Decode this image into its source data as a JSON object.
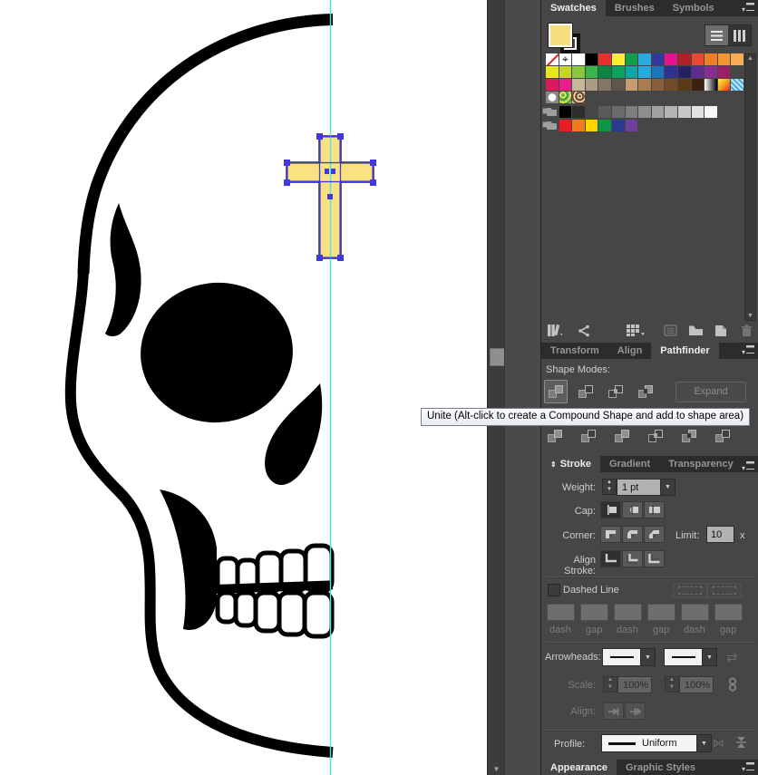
{
  "colors": {
    "canvas_bg": "#ffffff",
    "artwork": "#000000",
    "guide": "#44e6ef",
    "cross_fill": "#fae182",
    "cross_stroke": "#1f1f49",
    "selection": "#4038e0",
    "fill_proxy": "#f8df7d"
  },
  "canvas": {
    "artwork_name": "half-skull-drawing",
    "selected_object": "cross-shape"
  },
  "swatches_panel": {
    "tabs": [
      "Swatches",
      "Brushes",
      "Symbols"
    ],
    "active_tab": "Swatches",
    "view_buttons": [
      "list-view",
      "grid-view"
    ],
    "rows": [
      [
        "none",
        "registration",
        "#FFFFFF",
        "#000000",
        "#E8312F",
        "#FDEE2B",
        "#119E49",
        "#28AAE1",
        "#32399B",
        "#E8138C",
        "#B01F24",
        "#EA4835",
        "#EF7D23",
        "#F2952F",
        "#F6AC55"
      ],
      [
        "#E8E623",
        "#C6D32B",
        "#8CC63F",
        "#3AB54A",
        "#0C8442",
        "#0EA25F",
        "#10A5A5",
        "#28AAE1",
        "#1C75BC",
        "#2E3192",
        "#252163",
        "#5D2D91",
        "#8A2E92",
        "#9C1E63"
      ],
      [
        "#D91A5C",
        "#EC1E8C",
        "#C7B79C",
        "#AC9B82",
        "#837567",
        "#5F554B",
        "#C69C6D",
        "#A97D50",
        "#8A5D3B",
        "#734B24",
        "#5A3A17",
        "#3C220E",
        "grad-bw",
        "grad-fire",
        "pat-checker-blue"
      ],
      [
        "pat-dots",
        "pat-floral-green",
        "pat-texture-brown"
      ],
      [
        "folder",
        "#000000",
        "#2E2E2E",
        "#474747",
        "#5A5A5A",
        "#6B6B6B",
        "#7D7D7D",
        "#8F8F8F",
        "#A1A1A1",
        "#B4B4B4",
        "#C8C8C8",
        "#E2E2E2",
        "#F7F7F7"
      ],
      [
        "folder",
        "#EB1C24",
        "#F47A20",
        "#FFD400",
        "#0A9547",
        "#2A3B8F",
        "#6E4099"
      ]
    ],
    "footer_icons": [
      "swatch-libraries-menu",
      "add-selected",
      "show-swatch-kinds-menu",
      "swatch-options",
      "new-color-group",
      "new-swatch",
      "delete-swatch"
    ]
  },
  "pathfinder_panel": {
    "tabs": [
      "Transform",
      "Align",
      "Pathfinder"
    ],
    "active_tab": "Pathfinder",
    "section_label": "Shape Modes:",
    "shape_mode_buttons": [
      "unite",
      "minus-front",
      "intersect",
      "exclude"
    ],
    "expand_label": "Expand",
    "pathfinder_buttons": [
      "divide",
      "trim",
      "merge",
      "crop",
      "outline",
      "minus-back"
    ]
  },
  "tooltip": {
    "text": "Unite (Alt-click to create a Compound Shape and add to shape area)"
  },
  "stroke_panel": {
    "tabs": [
      "Stroke",
      "Gradient",
      "Transparency"
    ],
    "active_tab": "Stroke",
    "weight_label": "Weight:",
    "weight_value": "1 pt",
    "cap_label": "Cap:",
    "corner_label": "Corner:",
    "limit_label": "Limit:",
    "limit_value": "10",
    "limit_suffix": "x",
    "align_stroke_label": "Align Stroke:",
    "dashed_line_label": "Dashed Line",
    "dash_gap_labels": [
      "dash",
      "gap",
      "dash",
      "gap",
      "dash",
      "gap"
    ],
    "arrowheads_label": "Arrowheads:",
    "scale_label": "Scale:",
    "scale_values": [
      "100%",
      "100%"
    ],
    "align_label": "Align:",
    "profile_label": "Profile:",
    "profile_value": "Uniform"
  },
  "bottom_tabs": [
    "Appearance",
    "Graphic Styles"
  ],
  "bottom_active_tab": "Appearance"
}
